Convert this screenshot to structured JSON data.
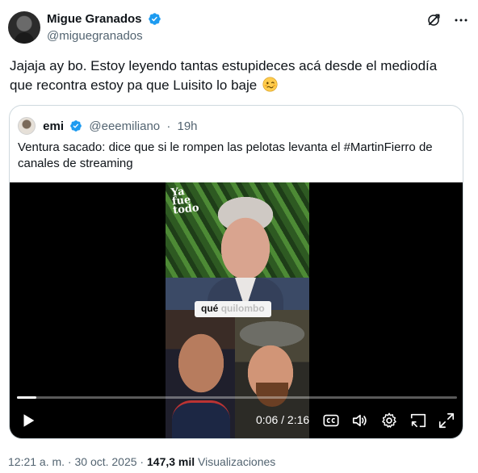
{
  "author": {
    "display_name": "Migue Granados",
    "handle": "@miguegranados",
    "verified": true
  },
  "tweet": {
    "text": "Jajaja ay bo. Estoy leyendo tantas estupideces acá desde el mediodía que recontra estoy pa que Luisito lo baje",
    "emoji": "woozy-face"
  },
  "quote": {
    "display_name": "emi",
    "handle": "@eeemiliano",
    "separator": "·",
    "time": "19h",
    "text": "Ventura sacado: dice que si le rompen las pelotas levanta el #MartinFierro de canales de streaming"
  },
  "video": {
    "brand_line1": "Ya",
    "brand_line2": "fue",
    "brand_line3": "todo",
    "caption_highlight": "qué",
    "caption_rest": "quilombo",
    "current_time": "0:06",
    "time_separator": "/",
    "duration": "2:16",
    "progress_fraction": 0.044
  },
  "footer": {
    "timestamp": "12:21 a. m. · 30 oct. 2025 ·",
    "views_count": "147,3 mil",
    "views_label": "Visualizaciones"
  },
  "colors": {
    "verified": "#1d9bf0",
    "text_primary": "#0f1419",
    "text_secondary": "#536471",
    "border": "#cfd9de"
  }
}
